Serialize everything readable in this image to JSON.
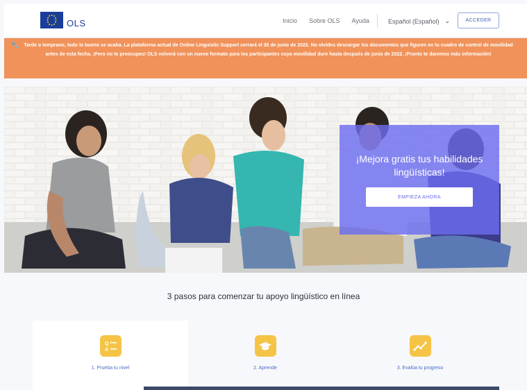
{
  "header": {
    "logo_text": "OLS",
    "nav": [
      "Inicio",
      "Sobre OLS",
      "Ayuda"
    ],
    "language": "Español (Español)",
    "access_button": "ACCEDER"
  },
  "banner": {
    "text": "Tarde o temprano, todo lo bueno se acaba. La plataforma actual de Online Linguistic Support cerrará el 30 de junio de 2022. No olvides descargar los documentos que figuren en tu cuadro de control de movilidad antes de esta fecha. ¡Pero no te preocupes! OLS volverá con un nuevo formato para los participantes cuya movilidad dure hasta después de junio de 2022. ¡Pronto te daremos más información!"
  },
  "hero": {
    "title": "¡Mejora gratis tus habilidades lingüísticas!",
    "button": "EMPIEZA AHORA"
  },
  "steps": {
    "title": "3 pasos para comenzar tu apoyo lingüístico en línea",
    "items": [
      {
        "label": "1. Prueba tu nivel",
        "icon": "quiz-icon"
      },
      {
        "label": "2. Aprende",
        "icon": "graduation-cap-icon"
      },
      {
        "label": "3. Evalúa tu progreso",
        "icon": "progress-chart-icon"
      }
    ]
  },
  "colors": {
    "brand_blue": "#1a3d9c",
    "banner_orange": "#f0925a",
    "hero_card": "#6c6cf0",
    "step_icon": "#f5c447",
    "link_blue": "#4a6bc4"
  }
}
